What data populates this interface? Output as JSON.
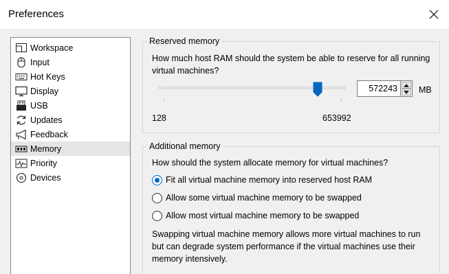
{
  "window": {
    "title": "Preferences",
    "close_icon": "close-icon"
  },
  "nav": {
    "items": [
      {
        "label": "Workspace",
        "icon": "workspace-icon",
        "selected": false
      },
      {
        "label": "Input",
        "icon": "mouse-icon",
        "selected": false
      },
      {
        "label": "Hot Keys",
        "icon": "keyboard-icon",
        "selected": false
      },
      {
        "label": "Display",
        "icon": "monitor-icon",
        "selected": false
      },
      {
        "label": "USB",
        "icon": "usb-icon",
        "selected": false
      },
      {
        "label": "Updates",
        "icon": "updates-icon",
        "selected": false
      },
      {
        "label": "Feedback",
        "icon": "feedback-icon",
        "selected": false
      },
      {
        "label": "Memory",
        "icon": "memory-icon",
        "selected": true
      },
      {
        "label": "Priority",
        "icon": "priority-icon",
        "selected": false
      },
      {
        "label": "Devices",
        "icon": "devices-icon",
        "selected": false
      }
    ]
  },
  "reserved_memory": {
    "group_title": "Reserved memory",
    "question": "How much host RAM should the system be able to reserve for all running virtual machines?",
    "slider": {
      "min_label": "128",
      "max_label": "653992",
      "value": 572243,
      "min": 128,
      "max": 653992
    },
    "spin_value": "572243",
    "unit": "MB"
  },
  "additional_memory": {
    "group_title": "Additional memory",
    "question": "How should the system allocate memory for virtual machines?",
    "options": [
      {
        "label": "Fit all virtual machine memory into reserved host RAM",
        "checked": true
      },
      {
        "label": "Allow some virtual machine memory to be swapped",
        "checked": false
      },
      {
        "label": "Allow most virtual machine memory to be swapped",
        "checked": false
      }
    ],
    "note": "Swapping virtual machine memory allows more virtual machines to run but can degrade system performance if the virtual machines use their memory intensively."
  },
  "colors": {
    "accent": "#0067c0",
    "selected_bg": "#e5e5e5",
    "background": "#f0f0f0"
  }
}
